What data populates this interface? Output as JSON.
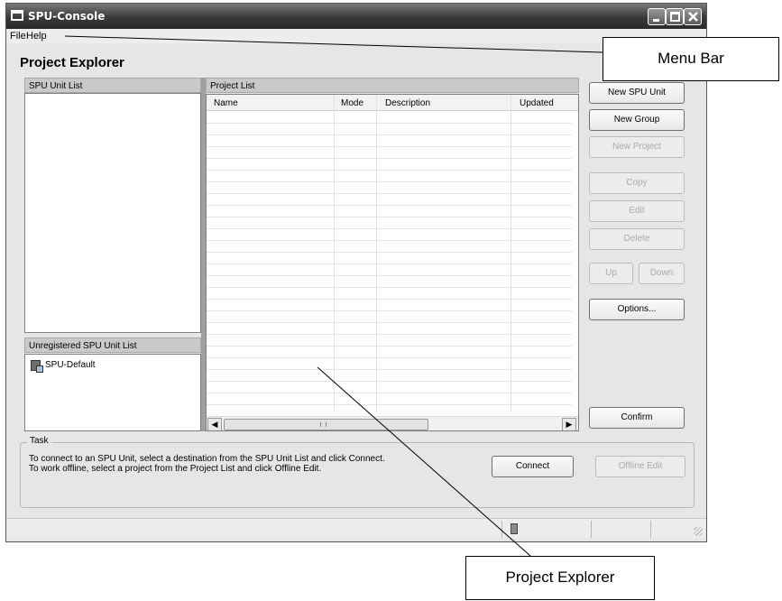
{
  "window": {
    "title": "SPU-Console"
  },
  "menu": {
    "file": "File",
    "help": "Help"
  },
  "heading": "Project Explorer",
  "panels": {
    "spu_unit_list": "SPU Unit List",
    "unregistered_list": "Unregistered SPU Unit List",
    "unregistered_items": [
      "SPU-Default"
    ],
    "project_list": "Project List"
  },
  "project_table": {
    "columns": [
      "Name",
      "Mode",
      "Description",
      "Updated"
    ],
    "rows": []
  },
  "buttons": {
    "new_spu_unit": "New SPU Unit",
    "new_group": "New Group",
    "new_project": "New Project",
    "copy": "Copy",
    "edit": "Edit",
    "delete": "Delete",
    "up": "Up",
    "down": "Down",
    "options": "Options...",
    "confirm": "Confirm",
    "connect": "Connect",
    "offline_edit": "Offline Edit"
  },
  "button_states": {
    "new_project": "disabled",
    "copy": "disabled",
    "edit": "disabled",
    "delete": "disabled",
    "up": "disabled",
    "down": "disabled",
    "offline_edit": "disabled"
  },
  "task": {
    "label": "Task",
    "line1": "To connect to an SPU Unit, select a destination from the SPU Unit List and click Connect.",
    "line2": "To work offline, select a project from the Project List and click Offline Edit."
  },
  "callouts": {
    "menu_bar": "Menu Bar",
    "project_explorer": "Project Explorer"
  },
  "icons": [
    "app-icon",
    "minimize-icon",
    "maximize-icon",
    "close-icon",
    "spu-unit-icon",
    "scroll-left-icon",
    "scroll-right-icon",
    "status-unit-icon",
    "resize-grip-icon"
  ],
  "colors": {
    "titlebar": "#3a3a3a",
    "window_bg": "#e6e6e6",
    "panel_header": "#c9c9c9",
    "disabled_text": "#aaaaaa"
  }
}
